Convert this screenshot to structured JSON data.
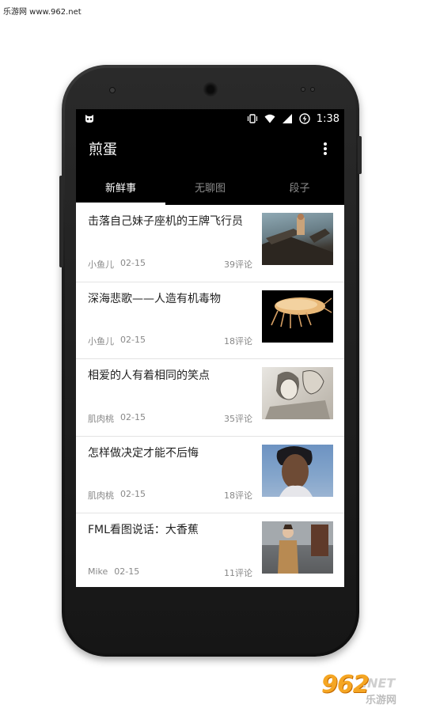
{
  "watermark": "乐游网 www.962.net",
  "status": {
    "time": "1:38"
  },
  "app": {
    "title": "煎蛋"
  },
  "tabs": [
    "新鲜事",
    "无聊图",
    "段子"
  ],
  "items": [
    {
      "title": "击落自己妹子座机的王牌飞行员",
      "author": "小鱼儿",
      "date": "02-15",
      "comments": "39评论"
    },
    {
      "title": "深海悲歌——人造有机毒物",
      "author": "小鱼儿",
      "date": "02-15",
      "comments": "18评论"
    },
    {
      "title": "相爱的人有着相同的笑点",
      "author": "肌肉桃",
      "date": "02-15",
      "comments": "35评论"
    },
    {
      "title": "怎样做决定才能不后悔",
      "author": "肌肉桃",
      "date": "02-15",
      "comments": "18评论"
    },
    {
      "title": "FML看图说话：大香蕉",
      "author": "Mike",
      "date": "02-15",
      "comments": "11评论"
    }
  ],
  "logo": {
    "number": "962",
    "suffix": ".NET",
    "cn": "乐游网"
  }
}
